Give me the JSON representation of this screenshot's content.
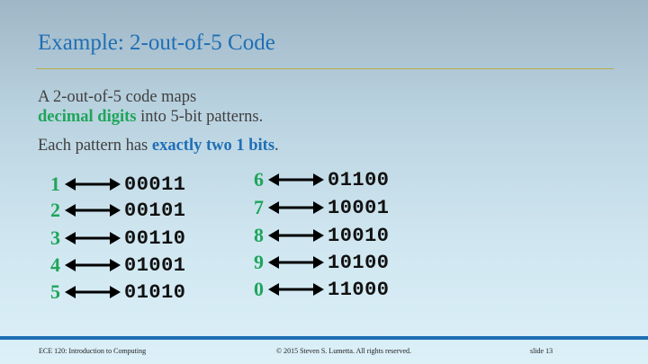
{
  "title": "Example: 2-out-of-5 Code",
  "body": {
    "line1": "A 2-out-of-5 code maps",
    "line2_highlight": "decimal digits",
    "line2_rest": " into 5-bit patterns.",
    "line3_start": "Each pattern has ",
    "line3_highlight": "exactly two 1 bits",
    "line3_end": "."
  },
  "mappings": [
    {
      "digit": "1",
      "code": "00011"
    },
    {
      "digit": "2",
      "code": "00101"
    },
    {
      "digit": "3",
      "code": "00110"
    },
    {
      "digit": "4",
      "code": "01001"
    },
    {
      "digit": "5",
      "code": "01010"
    },
    {
      "digit": "6",
      "code": "01100"
    },
    {
      "digit": "7",
      "code": "10001"
    },
    {
      "digit": "8",
      "code": "10010"
    },
    {
      "digit": "9",
      "code": "10100"
    },
    {
      "digit": "0",
      "code": "11000"
    }
  ],
  "footer": {
    "left": "ECE 120: Introduction to Computing",
    "center": "© 2015 Steven S. Lumetta.  All rights reserved.",
    "right": "slide 13"
  },
  "colors": {
    "title_blue": "#1f6fb5",
    "highlight_green": "#1ea55a",
    "rule_gold": "#b7a94a"
  }
}
